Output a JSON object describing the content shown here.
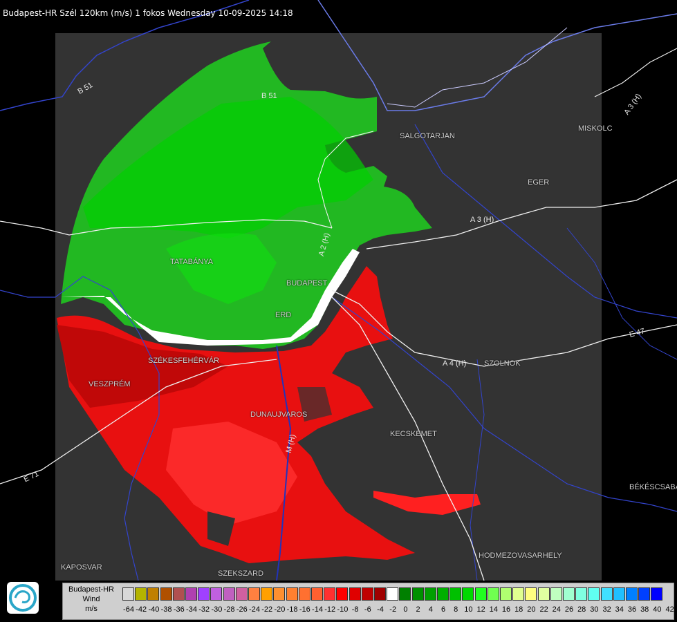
{
  "header": {
    "title": "Budapest-HR Szél 120km (m/s) 1 fokos Wednesday 10-09-2025 14:18"
  },
  "map": {
    "cities": [
      {
        "label": "SALGOTARJAN"
      },
      {
        "label": "MISKOLC"
      },
      {
        "label": "EGER"
      },
      {
        "label": "TATABÁNYA"
      },
      {
        "label": "BUDAPEST"
      },
      {
        "label": "ERD"
      },
      {
        "label": "SZÉKESFEHÉRVÁR"
      },
      {
        "label": "VESZPRÉM"
      },
      {
        "label": "DUNAUJVAROS"
      },
      {
        "label": "KECSKEMET"
      },
      {
        "label": "SZOLNOK"
      },
      {
        "label": "BÉKÉSCSABA"
      },
      {
        "label": "HODMEZOVASARHELY"
      },
      {
        "label": "KAPOSVAR"
      },
      {
        "label": "SZEKSZARD"
      }
    ],
    "roads": [
      {
        "label": "B 51"
      },
      {
        "label": "B 51"
      },
      {
        "label": "A 3 (H)"
      },
      {
        "label": "A 3 (H)"
      },
      {
        "label": "A 2 (H)"
      },
      {
        "label": "A 4 (H)"
      },
      {
        "label": "E 47"
      },
      {
        "label": "E 71"
      },
      {
        "label": "M (H)"
      }
    ],
    "colors": {
      "background": "#000000",
      "radar_area": "#333333",
      "approaching": "#00cc00",
      "receding": "#e60000",
      "borders": "#3344cc",
      "roads": "#ffffff"
    }
  },
  "legend": {
    "title_lines": [
      "Budapest-HR",
      "Wind",
      "m/s"
    ],
    "ticks": [
      "-64",
      "-42",
      "-40",
      "-38",
      "-36",
      "-34",
      "-32",
      "-30",
      "-28",
      "-26",
      "-24",
      "-22",
      "-20",
      "-18",
      "-16",
      "-14",
      "-12",
      "-10",
      "-8",
      "-6",
      "-4",
      "-2",
      "0",
      "2",
      "4",
      "6",
      "8",
      "10",
      "12",
      "14",
      "16",
      "18",
      "20",
      "22",
      "24",
      "26",
      "28",
      "30",
      "32",
      "34",
      "36",
      "38",
      "40",
      "42"
    ],
    "swatch_colors": [
      "#d8d8d8",
      "#b4b400",
      "#c08000",
      "#b05000",
      "#b05050",
      "#b040b0",
      "#a040ff",
      "#c060e0",
      "#c060c0",
      "#d060a0",
      "#ff8040",
      "#ffa000",
      "#ff9030",
      "#ff8030",
      "#ff7030",
      "#ff6030",
      "#ff3030",
      "#ff0000",
      "#e00000",
      "#c00000",
      "#a00000",
      "#ffffff",
      "#008000",
      "#009000",
      "#00a000",
      "#00b000",
      "#00c000",
      "#00d800",
      "#20ff20",
      "#70ff50",
      "#b0ff70",
      "#e0ff90",
      "#ffff80",
      "#e0ffa0",
      "#c0ffc0",
      "#a0ffd0",
      "#80ffe0",
      "#60fff0",
      "#40e0ff",
      "#20c0ff",
      "#0080ff",
      "#0040ff",
      "#0000ff"
    ]
  }
}
